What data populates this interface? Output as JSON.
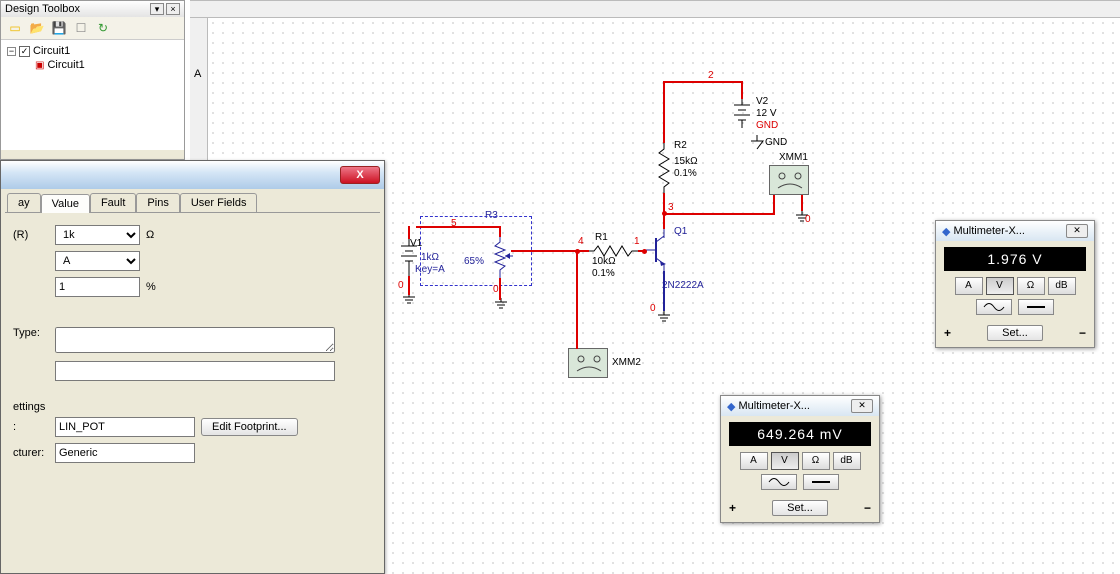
{
  "toolbox": {
    "title": "Design Toolbox",
    "root": "Circuit1",
    "child": "Circuit1"
  },
  "dialog": {
    "tabs": [
      "ay",
      "Value",
      "Fault",
      "Pins",
      "User Fields"
    ],
    "active_tab": 1,
    "r_label": "(R)",
    "r_value": "1k",
    "r_unit": "Ω",
    "key_value": "A",
    "pct_value": "1",
    "pct_unit": "%",
    "type_label": "Type:",
    "settings_label": "ettings",
    "fp_row_label": ":",
    "footprint": "LIN_POT",
    "edit_fp_btn": "Edit Footprint...",
    "mfr_label": "cturer:",
    "mfr": "Generic"
  },
  "schem": {
    "V1": {
      "name": "V1",
      "node_top": "5",
      "node_bot": "0"
    },
    "R3": {
      "name": "R3",
      "value": "1kΩ",
      "key": "Key=A",
      "pct": "65%",
      "nodes": {
        "a": "5",
        "b": "0"
      }
    },
    "R1": {
      "name": "R1",
      "value": "10kΩ",
      "tol": "0.1%",
      "nodes": {
        "a": "4",
        "b": "1"
      }
    },
    "R2": {
      "name": "R2",
      "value": "15kΩ",
      "tol": "0.1%",
      "nodes": {
        "a": "2",
        "b": "3"
      }
    },
    "Q1": {
      "name": "Q1",
      "model": "2N2222A",
      "nodes": {
        "c": "3",
        "b": "1",
        "e": "0"
      }
    },
    "V2": {
      "name": "V2",
      "value": "12 V",
      "gnd": "GND",
      "gnd2": "GND",
      "nodes": {
        "p": "2"
      }
    },
    "XMM1": {
      "name": "XMM1"
    },
    "XMM2": {
      "name": "XMM2"
    }
  },
  "mm1": {
    "title": "Multimeter-X...",
    "reading": "1.976 V",
    "btns": [
      "A",
      "V",
      "Ω",
      "dB"
    ],
    "set": "Set..."
  },
  "mm2": {
    "title": "Multimeter-X...",
    "reading": "649.264 mV",
    "btns": [
      "A",
      "V",
      "Ω",
      "dB"
    ],
    "set": "Set..."
  },
  "ruler": {
    "letter": "A"
  }
}
